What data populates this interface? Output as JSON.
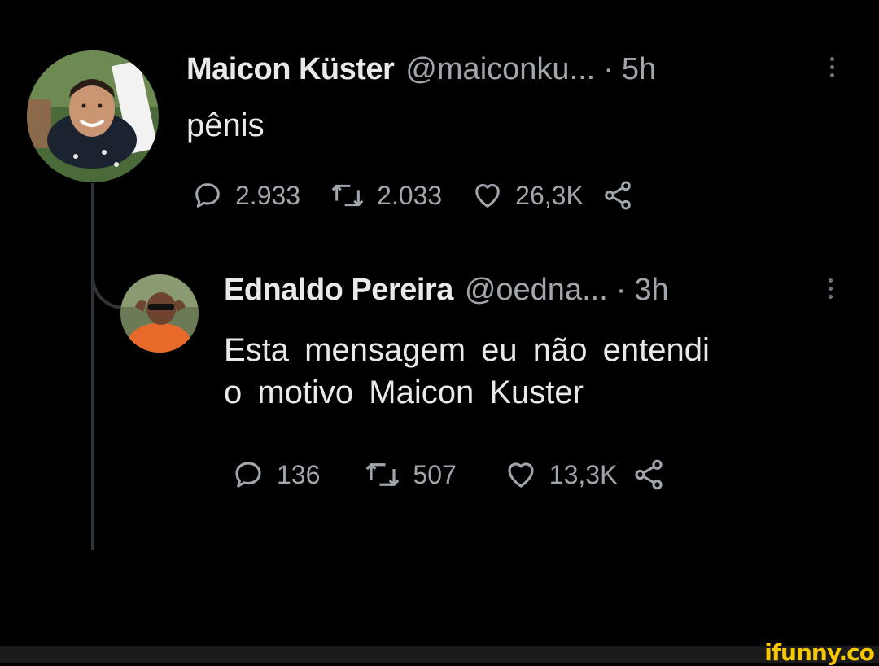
{
  "tweet": {
    "author_name": "Maicon Küster",
    "handle": "@maiconku...",
    "separator": "·",
    "time": "5h",
    "text": "pênis",
    "stats": {
      "replies": "2.933",
      "retweets": "2.033",
      "likes": "26,3K"
    }
  },
  "reply": {
    "author_name": "Ednaldo Pereira",
    "handle": "@oedna...",
    "separator": "·",
    "time": "3h",
    "text_lines": [
      "Esta  mensagem  eu não  entendi",
      "o motivo  Maicon Kuster"
    ],
    "stats": {
      "replies": "136",
      "retweets": "507",
      "likes": "13,3K"
    }
  },
  "watermark": "ifunny.co",
  "colors": {
    "background": "#000000",
    "text": "#e7e9ea",
    "muted": "#a0a6ab",
    "watermark": "#f6c700"
  }
}
